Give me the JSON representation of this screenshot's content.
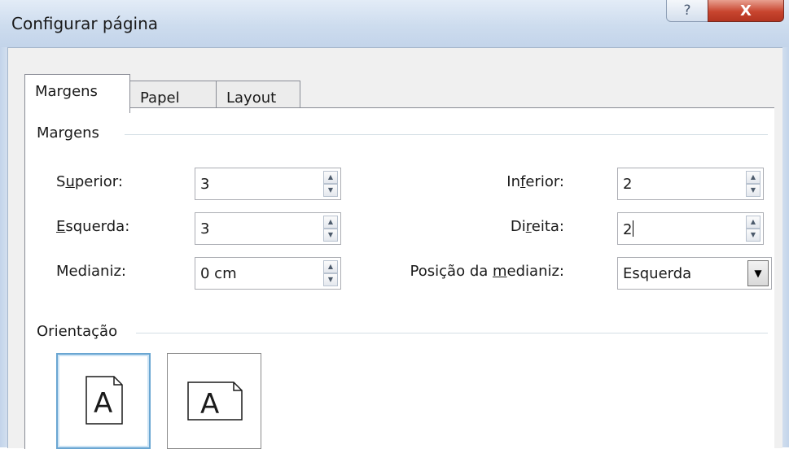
{
  "window": {
    "title": "Configurar página",
    "help_glyph": "?",
    "close_glyph": "X"
  },
  "tabs": [
    {
      "label": "Margens",
      "active": true
    },
    {
      "label": "Papel",
      "active": false
    },
    {
      "label": "Layout",
      "active": false
    }
  ],
  "margins": {
    "group_label": "Margens",
    "top": {
      "pre": "S",
      "key": "u",
      "post": "perior:",
      "value": "3"
    },
    "left": {
      "pre": "",
      "key": "E",
      "post": "squerda:",
      "value": "3"
    },
    "gutter": {
      "pre": "Medianiz",
      "key": "",
      "post": ":",
      "value": "0 cm"
    },
    "bottom": {
      "pre": "In",
      "key": "f",
      "post": "erior:",
      "value": "2"
    },
    "right": {
      "pre": "Di",
      "key": "r",
      "post": "eita:",
      "value": "2"
    },
    "gutter_position": {
      "pre": "Posição da ",
      "key": "m",
      "post": "edianiz:",
      "value": "Esquerda"
    }
  },
  "orientation": {
    "group_label": "Orientação",
    "portrait_glyph": "A",
    "landscape_glyph": "A",
    "selected": "portrait"
  },
  "icons": {
    "spin_up": "▲",
    "spin_down": "▼",
    "dropdown": "▼"
  }
}
